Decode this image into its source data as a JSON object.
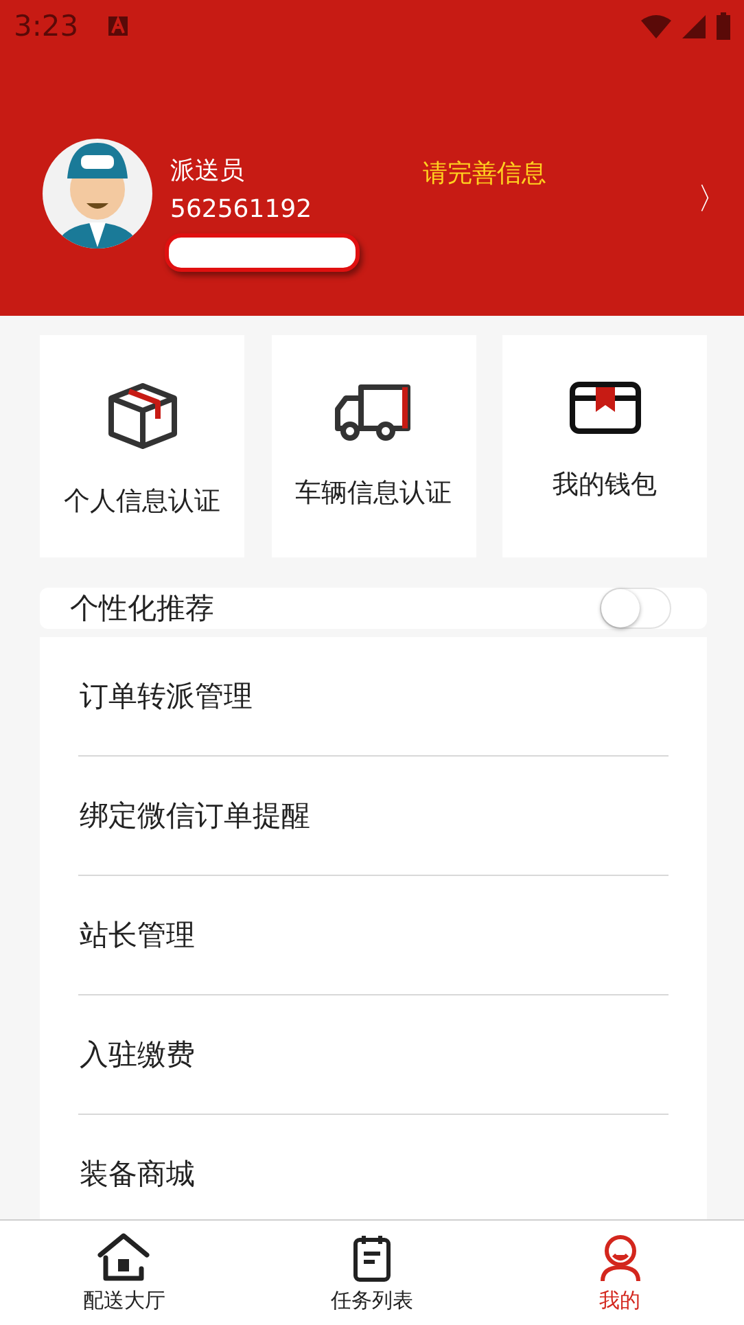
{
  "status_bar": {
    "time": "3:23"
  },
  "profile": {
    "role": "派送员",
    "id": "562561192",
    "prompt": "请完善信息",
    "chevron": "〉"
  },
  "quick_actions": [
    {
      "kind": "box",
      "label": "个人信息认证"
    },
    {
      "kind": "truck",
      "label": "车辆信息认证"
    },
    {
      "kind": "wallet",
      "label": "我的钱包"
    }
  ],
  "personalized": {
    "label": "个性化推荐",
    "on": false
  },
  "menu": [
    "订单转派管理",
    "绑定微信订单提醒",
    "站长管理",
    "入驻缴费",
    "装备商城"
  ],
  "tabs": [
    {
      "kind": "home",
      "label": "配送大厅",
      "selected": false
    },
    {
      "kind": "list",
      "label": "任务列表",
      "selected": false
    },
    {
      "kind": "me",
      "label": "我的",
      "selected": true
    }
  ]
}
